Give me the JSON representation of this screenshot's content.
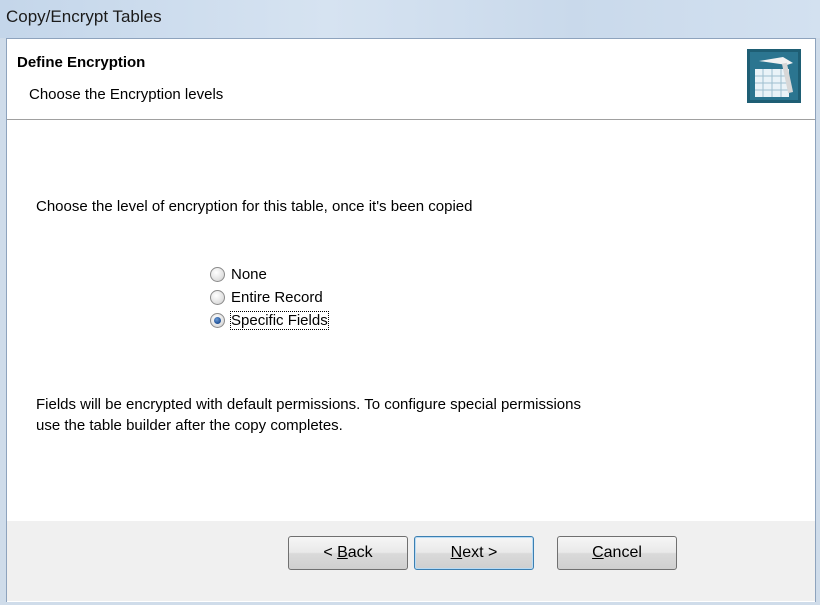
{
  "window": {
    "title": "Copy/Encrypt Tables"
  },
  "header": {
    "title": "Define Encryption",
    "subtitle": "Choose the Encryption levels",
    "logo_icon": "table-builder-logo-icon"
  },
  "content": {
    "prompt": "Choose the level of encryption  for this table, once it's been copied",
    "options": [
      {
        "label": "None",
        "checked": false
      },
      {
        "label": "Entire Record",
        "checked": false
      },
      {
        "label": "Specific Fields",
        "checked": true
      }
    ],
    "note_line1": "Fields will be encrypted with default permissions. To configure special permissions",
    "note_line2": "use the table builder after the copy completes."
  },
  "buttons": {
    "back_prefix": "< ",
    "back_mnemonic": "B",
    "back_rest": "ack",
    "next_prefix": "",
    "next_mnemonic": "N",
    "next_rest": "ext >",
    "cancel_mnemonic": "C",
    "cancel_rest": "ancel"
  },
  "colors": {
    "title_bar": "#c9d9eb",
    "default_button_border": "#3c7fb1",
    "radio_dot": "#1f4f95"
  }
}
